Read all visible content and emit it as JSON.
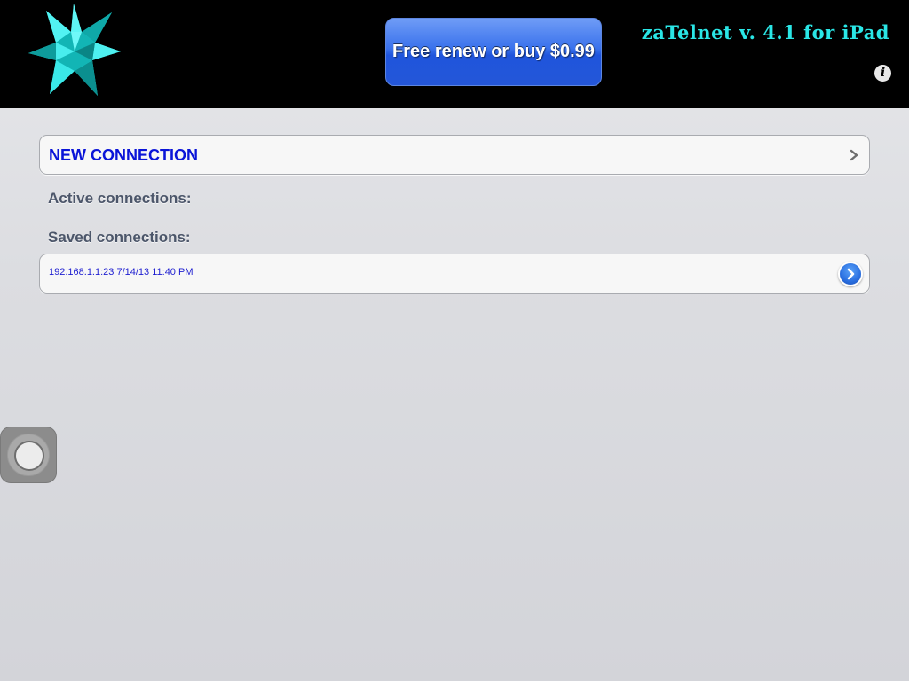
{
  "header": {
    "buy_button_label": "Free renew or buy $0.99",
    "app_title": "zaTelnet v. 4.1 for iPad",
    "info_glyph": "i"
  },
  "main": {
    "new_connection_label": "NEW CONNECTION",
    "active_connections_label": "Active connections:",
    "saved_connections_label": "Saved connections:",
    "saved_connections": [
      {
        "label": "192.168.1.1:23 7/14/13 11:40 PM"
      }
    ]
  },
  "icons": {
    "logo": "star-polyhedron-logo-icon",
    "new_connection_chevron": "chevron-right-icon",
    "saved_row_action": "disclosure-arrow-icon",
    "info": "info-icon",
    "assistive_touch": "assistive-touch-icon"
  },
  "colors": {
    "header_bg": "#000000",
    "title_cyan": "#2ae6e6",
    "link_blue": "#0a14d8",
    "button_blue": "#2456d8",
    "section_label": "#4c566a"
  }
}
